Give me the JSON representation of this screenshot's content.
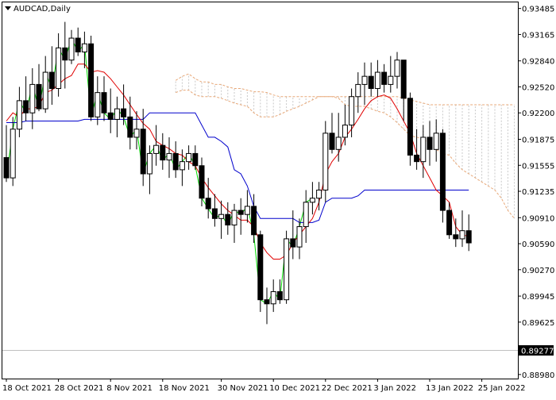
{
  "chart_data": {
    "type": "candlestick",
    "title": "AUDCAD,Daily",
    "indicator": "Ichimoku Kinko Hyo",
    "y_ticks": [
      "0.93485",
      "0.93165",
      "0.92840",
      "0.92520",
      "0.92200",
      "0.91875",
      "0.91555",
      "0.91235",
      "0.90910",
      "0.90590",
      "0.90270",
      "0.89945",
      "0.89625",
      "0.88980"
    ],
    "y_tick_values": [
      0.93485,
      0.93165,
      0.9284,
      0.9252,
      0.922,
      0.91875,
      0.91555,
      0.91235,
      0.9091,
      0.9059,
      0.9027,
      0.89945,
      0.89625,
      0.8898
    ],
    "ylim": [
      0.8893,
      0.9356
    ],
    "x_ticks": [
      "18 Oct 2021",
      "28 Oct 2021",
      "8 Nov 2021",
      "18 Nov 2021",
      "30 Nov 2021",
      "10 Dec 2021",
      "22 Dec 2021",
      "3 Jan 2022",
      "13 Jan 2022",
      "25 Jan 2022"
    ],
    "x_tick_index": [
      0,
      8,
      16,
      24,
      33,
      41,
      49,
      57,
      65,
      73
    ],
    "current_price": {
      "label": "0.89277",
      "value": 0.89277,
      "line_color": "#c0c0c0"
    },
    "colors": {
      "bull_body": "#ffffff",
      "bear_body": "#000000",
      "wick": "#000000",
      "tenkan": "#e00000",
      "kijun": "#0000cc",
      "chikou": "#00dd00",
      "senkou": "#e8a878",
      "cloud_hatch": "#c8c8c8"
    },
    "candles": [
      [
        0.9165,
        0.9205,
        0.9135,
        0.914
      ],
      [
        0.914,
        0.9215,
        0.913,
        0.92
      ],
      [
        0.92,
        0.9252,
        0.919,
        0.9235
      ],
      [
        0.9235,
        0.9265,
        0.921,
        0.922
      ],
      [
        0.922,
        0.9275,
        0.92,
        0.9255
      ],
      [
        0.9255,
        0.928,
        0.9222,
        0.9225
      ],
      [
        0.9225,
        0.929,
        0.922,
        0.927
      ],
      [
        0.927,
        0.9302,
        0.923,
        0.925
      ],
      [
        0.925,
        0.9318,
        0.924,
        0.93
      ],
      [
        0.93,
        0.9332,
        0.925,
        0.9285
      ],
      [
        0.9285,
        0.9322,
        0.928,
        0.9312
      ],
      [
        0.9312,
        0.9325,
        0.929,
        0.9295
      ],
      [
        0.9295,
        0.932,
        0.9275,
        0.9305
      ],
      [
        0.9305,
        0.9315,
        0.921,
        0.9215
      ],
      [
        0.9215,
        0.9265,
        0.9205,
        0.9245
      ],
      [
        0.9245,
        0.9265,
        0.921,
        0.922
      ],
      [
        0.922,
        0.925,
        0.9195,
        0.9212
      ],
      [
        0.9212,
        0.924,
        0.919,
        0.9225
      ],
      [
        0.9225,
        0.9255,
        0.9205,
        0.9215
      ],
      [
        0.9215,
        0.924,
        0.9175,
        0.919
      ],
      [
        0.919,
        0.9222,
        0.9175,
        0.92
      ],
      [
        0.92,
        0.9225,
        0.913,
        0.9145
      ],
      [
        0.9145,
        0.918,
        0.912,
        0.917
      ],
      [
        0.917,
        0.9205,
        0.9155,
        0.918
      ],
      [
        0.918,
        0.9195,
        0.915,
        0.9162
      ],
      [
        0.9162,
        0.919,
        0.914,
        0.917
      ],
      [
        0.917,
        0.9185,
        0.914,
        0.915
      ],
      [
        0.915,
        0.9175,
        0.913,
        0.916
      ],
      [
        0.916,
        0.918,
        0.915,
        0.917
      ],
      [
        0.917,
        0.918,
        0.915,
        0.9155
      ],
      [
        0.9155,
        0.9165,
        0.9105,
        0.9115
      ],
      [
        0.9115,
        0.914,
        0.909,
        0.9102
      ],
      [
        0.9102,
        0.912,
        0.908,
        0.909
      ],
      [
        0.909,
        0.9112,
        0.9065,
        0.9095
      ],
      [
        0.9095,
        0.911,
        0.907,
        0.9082
      ],
      [
        0.9082,
        0.9108,
        0.906,
        0.91
      ],
      [
        0.91,
        0.9115,
        0.907,
        0.9095
      ],
      [
        0.9095,
        0.9125,
        0.9085,
        0.9105
      ],
      [
        0.9105,
        0.912,
        0.906,
        0.907
      ],
      [
        0.907,
        0.9075,
        0.8975,
        0.899
      ],
      [
        0.899,
        0.9005,
        0.896,
        0.8985
      ],
      [
        0.8985,
        0.9015,
        0.8975,
        0.9
      ],
      [
        0.9,
        0.9015,
        0.8985,
        0.899
      ],
      [
        0.899,
        0.9075,
        0.8985,
        0.9065
      ],
      [
        0.9065,
        0.91,
        0.904,
        0.9055
      ],
      [
        0.9055,
        0.909,
        0.904,
        0.908
      ],
      [
        0.908,
        0.9125,
        0.906,
        0.911
      ],
      [
        0.911,
        0.9135,
        0.9095,
        0.9115
      ],
      [
        0.9115,
        0.9135,
        0.91,
        0.9125
      ],
      [
        0.9125,
        0.921,
        0.911,
        0.9195
      ],
      [
        0.9195,
        0.922,
        0.917,
        0.9175
      ],
      [
        0.9175,
        0.922,
        0.916,
        0.919
      ],
      [
        0.919,
        0.923,
        0.918,
        0.9205
      ],
      [
        0.9205,
        0.925,
        0.919,
        0.924
      ],
      [
        0.924,
        0.927,
        0.922,
        0.9255
      ],
      [
        0.9255,
        0.9282,
        0.923,
        0.9265
      ],
      [
        0.9265,
        0.9282,
        0.924,
        0.925
      ],
      [
        0.925,
        0.9285,
        0.924,
        0.927
      ],
      [
        0.927,
        0.928,
        0.9245,
        0.9255
      ],
      [
        0.9255,
        0.929,
        0.9245,
        0.9265
      ],
      [
        0.9265,
        0.9295,
        0.925,
        0.9285
      ],
      [
        0.9285,
        0.9285,
        0.921,
        0.9238
      ],
      [
        0.9238,
        0.9245,
        0.9155,
        0.9168
      ],
      [
        0.9168,
        0.92,
        0.915,
        0.916
      ],
      [
        0.916,
        0.9205,
        0.914,
        0.919
      ],
      [
        0.919,
        0.921,
        0.9155,
        0.9175
      ],
      [
        0.9175,
        0.9212,
        0.916,
        0.9195
      ],
      [
        0.9195,
        0.92,
        0.9085,
        0.91
      ],
      [
        0.91,
        0.911,
        0.9065,
        0.907
      ],
      [
        0.907,
        0.909,
        0.9055,
        0.9065
      ],
      [
        0.9065,
        0.91,
        0.9055,
        0.9075
      ],
      [
        0.9075,
        0.9095,
        0.905,
        0.906
      ]
    ],
    "tenkan": [
      0.921,
      0.922,
      0.9215,
      0.9225,
      0.9225,
      0.9228,
      0.9245,
      0.9248,
      0.9255,
      0.9262,
      0.9266,
      0.928,
      0.928,
      0.927,
      0.9272,
      0.927,
      0.9262,
      0.9252,
      0.9242,
      0.923,
      0.9218,
      0.9207,
      0.92,
      0.9185,
      0.918,
      0.9176,
      0.917,
      0.9168,
      0.916,
      0.9155,
      0.914,
      0.9128,
      0.9118,
      0.9108,
      0.91,
      0.9094,
      0.9088,
      0.9088,
      0.908,
      0.906,
      0.9048,
      0.904,
      0.904,
      0.9045,
      0.906,
      0.907,
      0.908,
      0.909,
      0.911,
      0.9145,
      0.916,
      0.917,
      0.919,
      0.92,
      0.9212,
      0.9225,
      0.9235,
      0.924,
      0.9242,
      0.9238,
      0.9225,
      0.921,
      0.9195,
      0.917,
      0.9155,
      0.914,
      0.9125,
      0.9118,
      0.911,
      0.908,
      0.907,
      0.9068
    ],
    "kijun": [
      0.9208,
      0.9208,
      0.9208,
      0.921,
      0.921,
      0.921,
      0.921,
      0.921,
      0.921,
      0.921,
      0.921,
      0.921,
      0.9212,
      0.9212,
      0.9212,
      0.9212,
      0.9212,
      0.9212,
      0.9212,
      0.9212,
      0.9212,
      0.9212,
      0.922,
      0.922,
      0.922,
      0.922,
      0.922,
      0.922,
      0.922,
      0.922,
      0.9205,
      0.919,
      0.919,
      0.9185,
      0.9178,
      0.915,
      0.9145,
      0.913,
      0.9105,
      0.909,
      0.909,
      0.909,
      0.909,
      0.909,
      0.909,
      0.9085,
      0.9085,
      0.9085,
      0.9088,
      0.911,
      0.9115,
      0.9115,
      0.9115,
      0.9115,
      0.9118,
      0.9125,
      0.9125,
      0.9125,
      0.9125,
      0.9125,
      0.9125,
      0.9125,
      0.9125,
      0.9125,
      0.9125,
      0.9125,
      0.9125,
      0.9125,
      0.9125,
      0.9125,
      0.9125,
      0.9125
    ],
    "chikou": [
      0.914,
      0.92,
      0.9235,
      0.922,
      0.9255,
      0.9225,
      0.927,
      0.925,
      0.93,
      0.9285,
      0.9312,
      0.9295,
      0.9305,
      0.9215,
      0.9245,
      0.922,
      0.9212,
      0.9225,
      0.9215,
      0.919,
      0.92,
      0.9145,
      0.917,
      0.918,
      0.9162,
      0.917,
      0.915,
      0.916,
      0.917,
      0.9155,
      0.9115,
      0.9102,
      0.909,
      0.9095,
      0.9082,
      0.91,
      0.9095,
      0.9105,
      0.907,
      0.899,
      0.8985,
      0.9,
      0.899,
      0.9065,
      0.9055,
      0.908,
      0.911,
      0.9115
    ],
    "senkou_a": [
      0.9245,
      0.9248,
      0.9248,
      0.9242,
      0.924,
      0.924,
      0.924,
      0.9238,
      0.9235,
      0.9232,
      0.923,
      0.9228,
      0.922,
      0.9215,
      0.9215,
      0.9215,
      0.9218,
      0.9222,
      0.9225,
      0.9228,
      0.9232,
      0.9236,
      0.924,
      0.924,
      0.924,
      0.9238,
      0.923,
      0.9228,
      0.9228,
      0.9228,
      0.9225,
      0.9222,
      0.922,
      0.9215,
      0.9208,
      0.92,
      0.9192,
      0.919,
      0.9188,
      0.9182,
      0.9175,
      0.917,
      0.9168,
      0.9158,
      0.915,
      0.9145,
      0.914,
      0.9135,
      0.913,
      0.9125,
      0.9115,
      0.91,
      0.909,
      0.9088,
      0.908,
      0.908,
      0.9085,
      0.9085,
      0.909,
      0.909,
      0.9095,
      0.91,
      0.9095,
      0.9095,
      0.91,
      0.911,
      0.9118,
      0.9122,
      0.913,
      0.914,
      0.915,
      0.916,
      0.917,
      0.9172,
      0.9172,
      0.9172,
      0.9172,
      0.9172,
      0.9172,
      0.9172
    ],
    "senkou_b": [
      0.926,
      0.9265,
      0.9268,
      0.9262,
      0.9258,
      0.9258,
      0.9255,
      0.9255,
      0.9252,
      0.925,
      0.925,
      0.9248,
      0.9246,
      0.9246,
      0.9245,
      0.9242,
      0.924,
      0.924,
      0.924,
      0.924,
      0.924,
      0.924,
      0.924,
      0.924,
      0.924,
      0.924,
      0.924,
      0.924,
      0.924,
      0.924,
      0.924,
      0.924,
      0.924,
      0.924,
      0.924,
      0.9238,
      0.9236,
      0.9234,
      0.9232,
      0.923,
      0.923,
      0.923,
      0.923,
      0.923,
      0.923,
      0.923,
      0.923,
      0.923,
      0.923,
      0.923,
      0.923,
      0.923,
      0.923,
      0.923,
      0.923,
      0.9225,
      0.9218,
      0.9205,
      0.9195,
      0.9185,
      0.917,
      0.916,
      0.9155,
      0.9155,
      0.9155,
      0.9155,
      0.9155,
      0.9155,
      0.9155,
      0.9155,
      0.9155,
      0.9155,
      0.9155,
      0.9155,
      0.9155,
      0.9155,
      0.9155,
      0.9155,
      0.9155,
      0.9155
    ]
  }
}
